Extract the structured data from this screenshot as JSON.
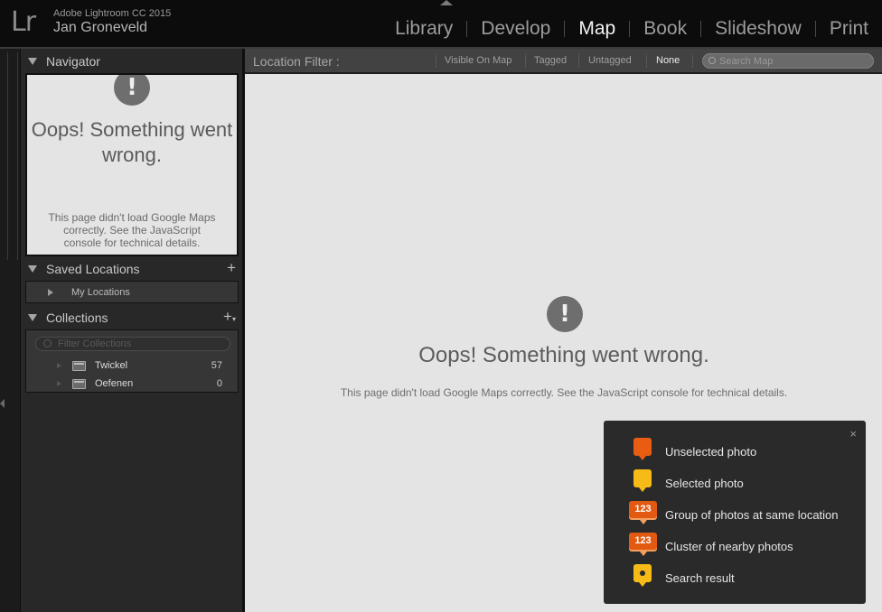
{
  "app": {
    "logo": "Lr",
    "name": "Adobe Lightroom CC 2015",
    "user": "Jan Groneveld"
  },
  "modules": [
    "Library",
    "Develop",
    "Map",
    "Book",
    "Slideshow",
    "Print"
  ],
  "active_module": "Map",
  "navigator": {
    "title": "Navigator",
    "error_icon": "!",
    "error_title": "Oops! Something went wrong.",
    "error_text": "This page didn't load Google Maps correctly. See the JavaScript console for technical details."
  },
  "saved_locations": {
    "title": "Saved Locations",
    "add": "+",
    "item": "My Locations"
  },
  "collections": {
    "title": "Collections",
    "add": "+",
    "filter_placeholder": "Filter Collections",
    "items": [
      {
        "name": "Twickel",
        "count": "57"
      },
      {
        "name": "Oefenen",
        "count": "0"
      }
    ]
  },
  "filter_bar": {
    "label": "Location Filter :",
    "options": [
      "Visible On Map",
      "Tagged",
      "Untagged",
      "None"
    ],
    "active": "None",
    "search_placeholder": "Search Map"
  },
  "map": {
    "error_icon": "!",
    "error_title": "Oops! Something went wrong.",
    "error_text": "This page didn't load Google Maps correctly. See the JavaScript console for technical details."
  },
  "legend": {
    "close": "×",
    "items": [
      {
        "label": "Unselected photo",
        "icon": "unselected-pin-icon"
      },
      {
        "label": "Selected photo",
        "icon": "selected-pin-icon"
      },
      {
        "label": "Group of photos at same location",
        "icon": "group-badge-icon",
        "badge": "123"
      },
      {
        "label": "Cluster of nearby photos",
        "icon": "cluster-badge-icon",
        "badge": "123"
      },
      {
        "label": "Search result",
        "icon": "search-result-pin-icon"
      }
    ]
  },
  "colors": {
    "unselected_pin": "#e85d12",
    "selected_pin": "#f6bb16",
    "map_background": "#e4e4e4"
  }
}
